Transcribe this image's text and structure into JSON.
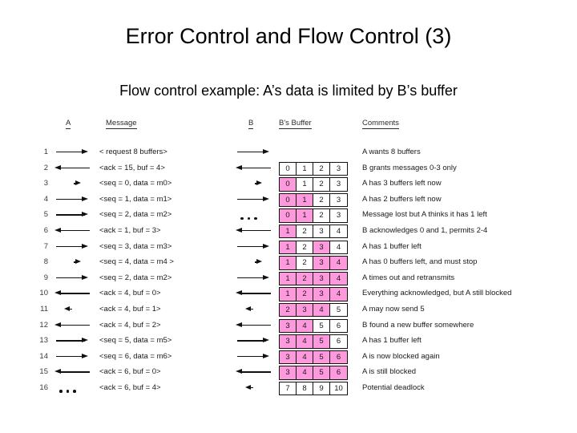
{
  "slide": {
    "title": "Error Control and Flow Control (3)",
    "subtitle": "Flow control example: A’s data is limited by B’s buffer"
  },
  "colors": {
    "buffer_filled": "#FF99DD",
    "buffer_empty": "#FFFFFF",
    "text": "#000000",
    "grid_line": "#111111"
  },
  "table": {
    "headers": {
      "a": "A",
      "message": "Message",
      "b": "B",
      "bbuffer": "B's Buffer",
      "comments": "Comments"
    },
    "rows": [
      {
        "num": "1",
        "arrow_a": "right",
        "message": "< request 8 buffers>",
        "arrow_b": "right",
        "buffer": null,
        "comment": "A wants 8 buffers"
      },
      {
        "num": "2",
        "arrow_a": "left",
        "message": "<ack = 15, buf = 4>",
        "arrow_b": "left",
        "buffer": {
          "values": [
            "0",
            "1",
            "2",
            "3"
          ],
          "filled": [
            false,
            false,
            false,
            false
          ]
        },
        "comment": "B grants messages 0-3 only"
      },
      {
        "num": "3",
        "arrow_a": "short-right",
        "message": "<seq = 0, data = m0>",
        "arrow_b": "short-right",
        "buffer": {
          "values": [
            "0",
            "1",
            "2",
            "3"
          ],
          "filled": [
            true,
            false,
            false,
            false
          ]
        },
        "comment": "A has 3 buffers left now"
      },
      {
        "num": "4",
        "arrow_a": "right",
        "message": "<seq = 1, data = m1>",
        "arrow_b": "right",
        "buffer": {
          "values": [
            "0",
            "1",
            "2",
            "3"
          ],
          "filled": [
            true,
            true,
            false,
            false
          ]
        },
        "comment": "A has 2 buffers left now"
      },
      {
        "num": "5",
        "arrow_a": "right",
        "message": "<seq = 2, data = m2>",
        "arrow_b": "dots",
        "buffer": {
          "values": [
            "0",
            "1",
            "2",
            "3"
          ],
          "filled": [
            true,
            true,
            false,
            false
          ]
        },
        "comment": "Message lost but A thinks it has 1 left"
      },
      {
        "num": "6",
        "arrow_a": "left",
        "message": "<ack = 1, buf = 3>",
        "arrow_b": "left",
        "buffer": {
          "values": [
            "1",
            "2",
            "3",
            "4"
          ],
          "filled": [
            true,
            false,
            false,
            false
          ]
        },
        "comment": "B acknowledges 0 and 1, permits 2-4"
      },
      {
        "num": "7",
        "arrow_a": "right",
        "message": "<seq = 3, data = m3>",
        "arrow_b": "right",
        "buffer": {
          "values": [
            "1",
            "2",
            "3",
            "4"
          ],
          "filled": [
            true,
            false,
            true,
            false
          ]
        },
        "comment": "A has 1 buffer left"
      },
      {
        "num": "8",
        "arrow_a": "short-right",
        "message": "<seq = 4, data = m4 >",
        "arrow_b": "short-right",
        "buffer": {
          "values": [
            "1",
            "2",
            "3",
            "4"
          ],
          "filled": [
            true,
            false,
            true,
            true
          ]
        },
        "comment": "A has 0 buffers left, and must stop"
      },
      {
        "num": "9",
        "arrow_a": "right",
        "message": "<seq = 2, data = m2>",
        "arrow_b": "right",
        "buffer": {
          "values": [
            "1",
            "2",
            "3",
            "4"
          ],
          "filled": [
            true,
            true,
            true,
            true
          ]
        },
        "comment": "A times out and retransmits"
      },
      {
        "num": "10",
        "arrow_a": "left",
        "message": "<ack = 4, buf = 0>",
        "arrow_b": "left",
        "buffer": {
          "values": [
            "1",
            "2",
            "3",
            "4"
          ],
          "filled": [
            true,
            true,
            true,
            true
          ]
        },
        "comment": "Everything acknowledged, but A still blocked"
      },
      {
        "num": "11",
        "arrow_a": "short-left",
        "message": "<ack = 4, buf = 1>",
        "arrow_b": "short-left",
        "buffer": {
          "values": [
            "2",
            "3",
            "4",
            "5"
          ],
          "filled": [
            true,
            true,
            true,
            false
          ]
        },
        "comment": "A may now send 5"
      },
      {
        "num": "12",
        "arrow_a": "left",
        "message": "<ack = 4, buf = 2>",
        "arrow_b": "left",
        "buffer": {
          "values": [
            "3",
            "4",
            "5",
            "6"
          ],
          "filled": [
            true,
            true,
            false,
            false
          ]
        },
        "comment": "B found a new buffer somewhere"
      },
      {
        "num": "13",
        "arrow_a": "right",
        "message": "<seq = 5, data = m5>",
        "arrow_b": "right",
        "buffer": {
          "values": [
            "3",
            "4",
            "5",
            "6"
          ],
          "filled": [
            true,
            true,
            true,
            false
          ]
        },
        "comment": "A has 1 buffer left"
      },
      {
        "num": "14",
        "arrow_a": "right",
        "message": "<seq = 6, data = m6>",
        "arrow_b": "right",
        "buffer": {
          "values": [
            "3",
            "4",
            "5",
            "6"
          ],
          "filled": [
            true,
            true,
            true,
            true
          ]
        },
        "comment": "A is now blocked again"
      },
      {
        "num": "15",
        "arrow_a": "left",
        "message": "<ack = 6, buf = 0>",
        "arrow_b": "left",
        "buffer": {
          "values": [
            "3",
            "4",
            "5",
            "6"
          ],
          "filled": [
            true,
            true,
            true,
            true
          ]
        },
        "comment": "A is still blocked"
      },
      {
        "num": "16",
        "arrow_a": "dots",
        "message": "<ack = 6, buf = 4>",
        "arrow_b": "short-left",
        "buffer": {
          "values": [
            "7",
            "8",
            "9",
            "10"
          ],
          "filled": [
            false,
            false,
            false,
            false
          ]
        },
        "comment": "Potential deadlock"
      }
    ]
  }
}
